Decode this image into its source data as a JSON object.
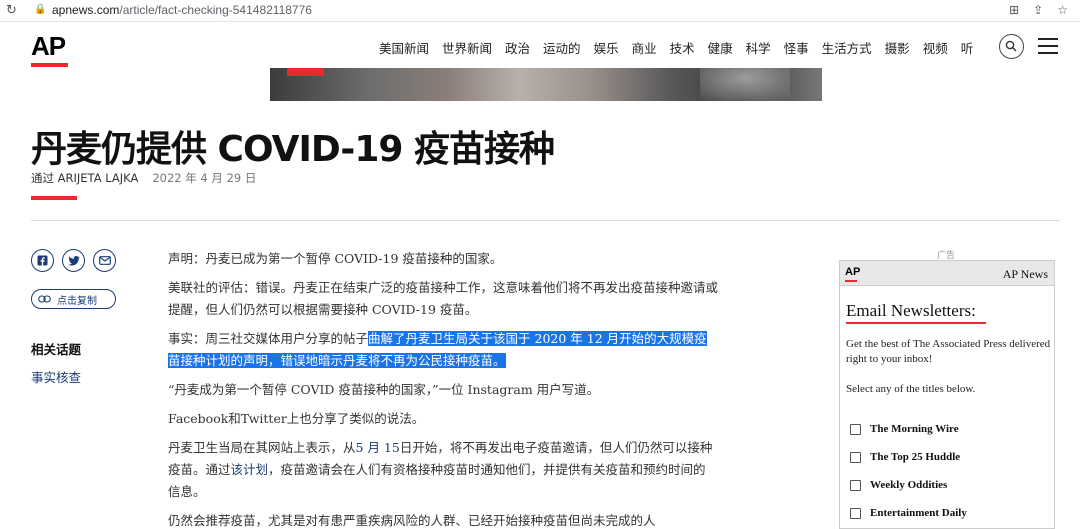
{
  "browser": {
    "url_domain": "apnews.com",
    "url_path": "/article/fact-checking-541482118776"
  },
  "site": {
    "logo": "AP",
    "nav": [
      "美国新闻",
      "世界新闻",
      "政治",
      "运动的",
      "娱乐",
      "商业",
      "技术",
      "健康",
      "科学",
      "怪事",
      "生活方式",
      "摄影",
      "视频",
      "听"
    ]
  },
  "article": {
    "headline": "丹麦仍提供 COVID-19 疫苗接种",
    "byline": "通过 ARIJETA LAJKA",
    "date": "2022 年 4 月 29 日",
    "copy_label": "点击复制",
    "topics_label": "相关话题",
    "topic": "事实核查",
    "p1": "声明：丹麦已成为第一个暂停 COVID-19 疫苗接种的国家。",
    "p2": "美联社的评估：错误。丹麦正在结束广泛的疫苗接种工作，这意味着他们将不再发出疫苗接种邀请或提醒，但人们仍然可以根据需要接种 COVID-19 疫苗。",
    "p3_plain": "事实：周三社交媒体用户分享的帖子",
    "p3_highlight": "曲解了丹麦卫生局关于该国于 2020 年 12 月开始的大规模疫苗接种计划的声明，错误地暗示丹麦将不再为公民接种疫苗。",
    "p4": "“丹麦成为第一个暂停 COVID 疫苗接种的国家，”一位 Instagram 用户写道。",
    "p5": "Facebook和Twitter上也分享了类似的说法。",
    "p6_a": "丹麦卫生当局在其网站上表示，从",
    "p6_link1": "5 月 15",
    "p6_b": "日开始，将不再发出电子疫苗邀请，但人们仍然可以接种疫苗。通过",
    "p6_link2": "该计划",
    "p6_c": "，疫苗邀请会在人们有资格接种疫苗时通知他们，并提供有关疫苗和预约时间的信息。",
    "p7": "仍然会推荐疫苗，尤其是对有患严重疾病风险的人群、已经开始接种疫苗但尚未完成的人"
  },
  "ad": {
    "label": "广告",
    "logo": "AP",
    "brand": "AP News",
    "title": "Email Newsletters:",
    "desc": "Get the best of The Associated Press delivered right to your inbox!",
    "select": "Select any of the titles below.",
    "newsletters": [
      "The Morning Wire",
      "The Top 25 Huddle",
      "Weekly Oddities",
      "Entertainment Daily"
    ]
  },
  "colors": {
    "accent": "#e8292d",
    "link": "#1a3c77",
    "selection": "#1a73e8"
  }
}
